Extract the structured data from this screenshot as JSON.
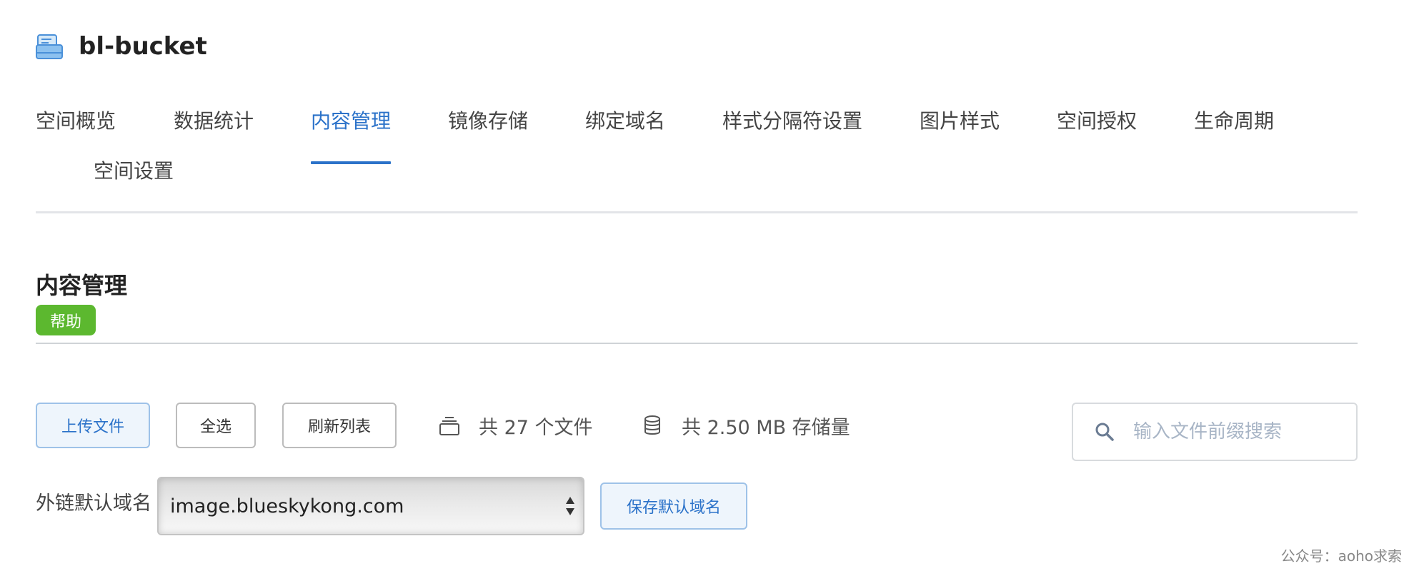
{
  "bucket": {
    "name": "bl-bucket",
    "icon": "bucket-folder-icon"
  },
  "tabs": [
    {
      "label": "空间概览",
      "active": false
    },
    {
      "label": "数据统计",
      "active": false
    },
    {
      "label": "内容管理",
      "active": true
    },
    {
      "label": "镜像存储",
      "active": false
    },
    {
      "label": "绑定域名",
      "active": false
    },
    {
      "label": "样式分隔符设置",
      "active": false
    },
    {
      "label": "图片样式",
      "active": false
    },
    {
      "label": "空间授权",
      "active": false
    },
    {
      "label": "生命周期",
      "active": false
    },
    {
      "label": "空间设置",
      "active": false
    }
  ],
  "section": {
    "title": "内容管理",
    "help_label": "帮助"
  },
  "toolbar": {
    "upload_label": "上传文件",
    "select_all_label": "全选",
    "refresh_label": "刷新列表",
    "file_count_text": "共 27 个文件",
    "storage_text": "共 2.50 MB 存储量",
    "file_count_icon": "stack-icon",
    "storage_icon": "database-icon"
  },
  "search": {
    "placeholder": "输入文件前缀搜索",
    "value": ""
  },
  "domain": {
    "label": "外链默认域名",
    "selected": "image.blueskykong.com",
    "save_label": "保存默认域名"
  },
  "watermark": "公众号：aoho求索",
  "colors": {
    "accent": "#2b72c9",
    "help_badge": "#5cb82f",
    "primary_button_bg": "#eef5fc"
  }
}
